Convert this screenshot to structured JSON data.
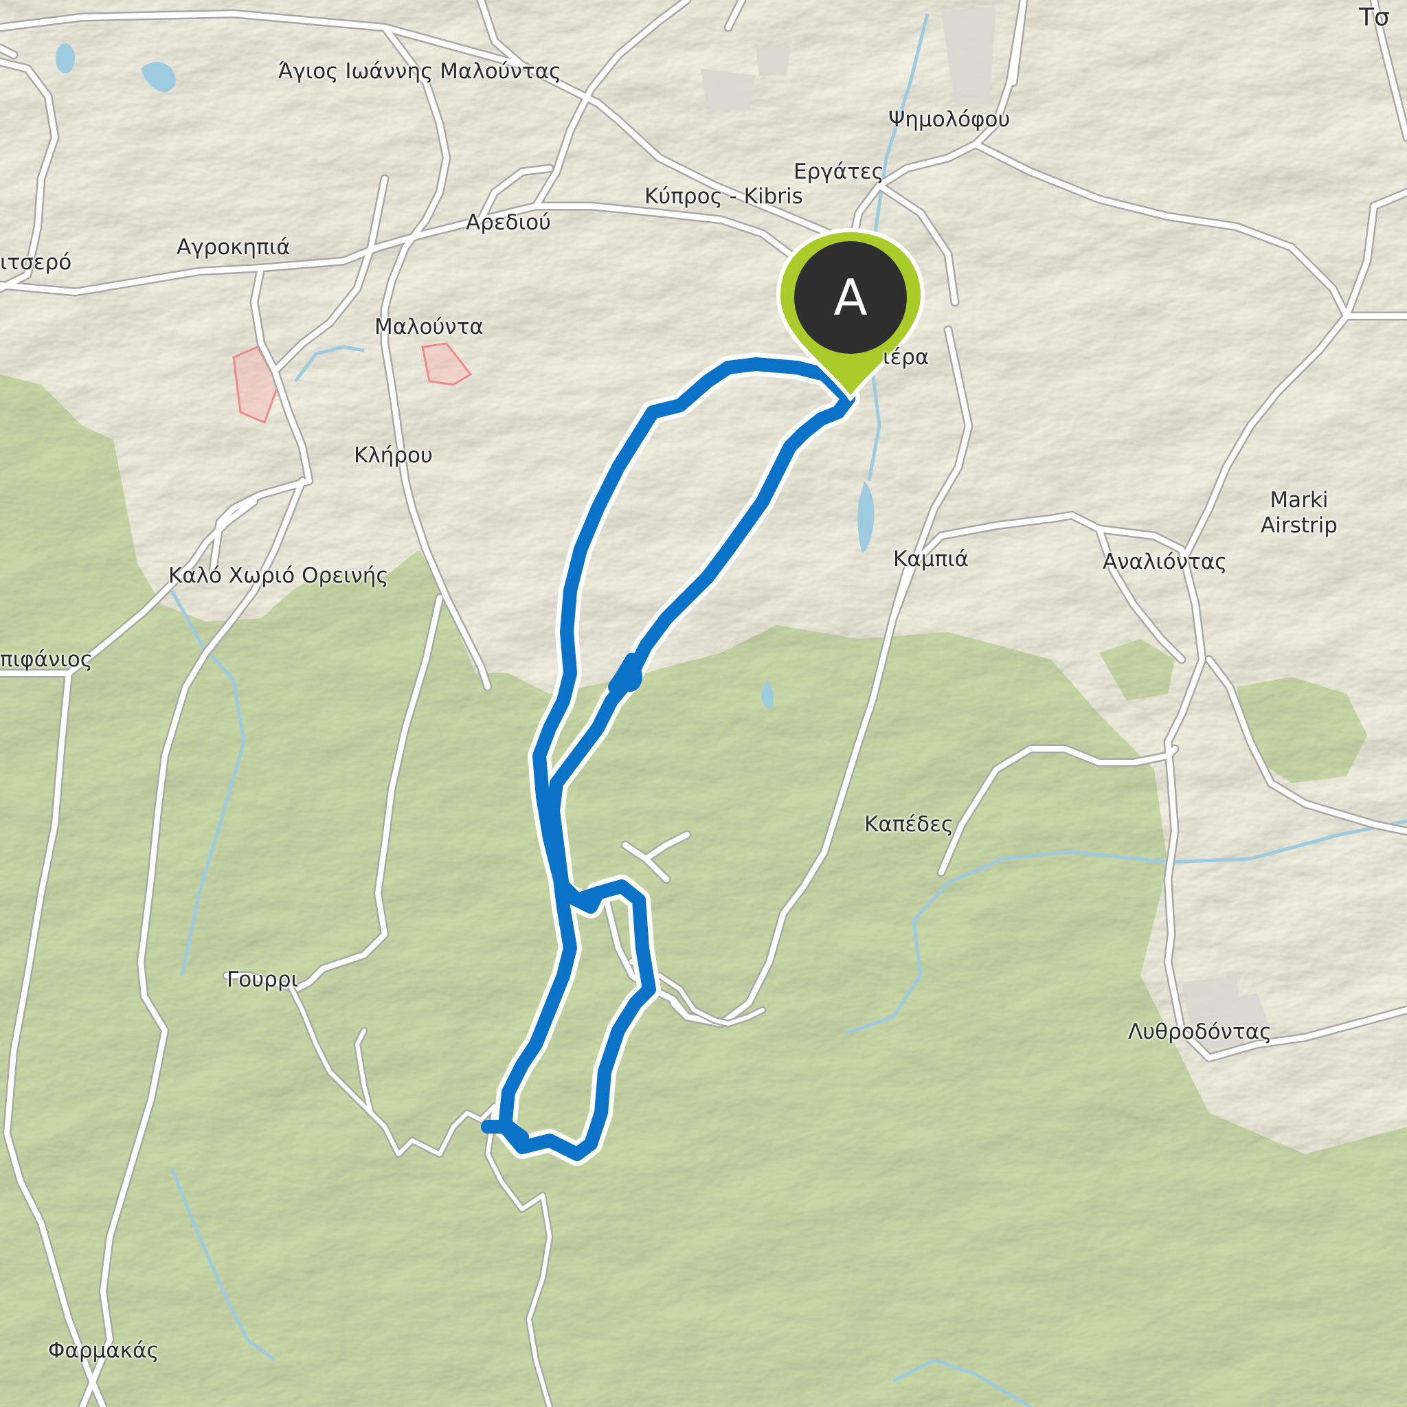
{
  "map": {
    "colors": {
      "lowland": "#efeee0",
      "forest": "#c9d9a5",
      "road": "#ffffff",
      "road_casing": "#a9a9a4",
      "water": "#9fcbe0",
      "route": "#0a73c8",
      "route_casing": "#ffffff",
      "marker_fill": "#a9cc2a",
      "marker_disc": "#2e2e2e"
    },
    "places": [
      "Άγιος Ιωάννης Μαλούντας",
      "Ψημολόφου",
      "Εργάτες",
      "Κύπρος - Kibris",
      "Αρεδιού",
      "Αγροκηπιά",
      "ιτσερό",
      "Μαλούντα",
      "ιέρα",
      "Κλήρου",
      "Marki\nAirstrip",
      "Καμπιά",
      "Αναλιόντας",
      "Καλό Χωριό Ορεινής",
      "πιφάνιος",
      "Καπέδες",
      "Γουρρι",
      "Λυθροδόντας",
      "Φαρμακάς",
      "Τσ"
    ],
    "marker": {
      "label": "A",
      "icon": "map-pin-icon"
    }
  }
}
